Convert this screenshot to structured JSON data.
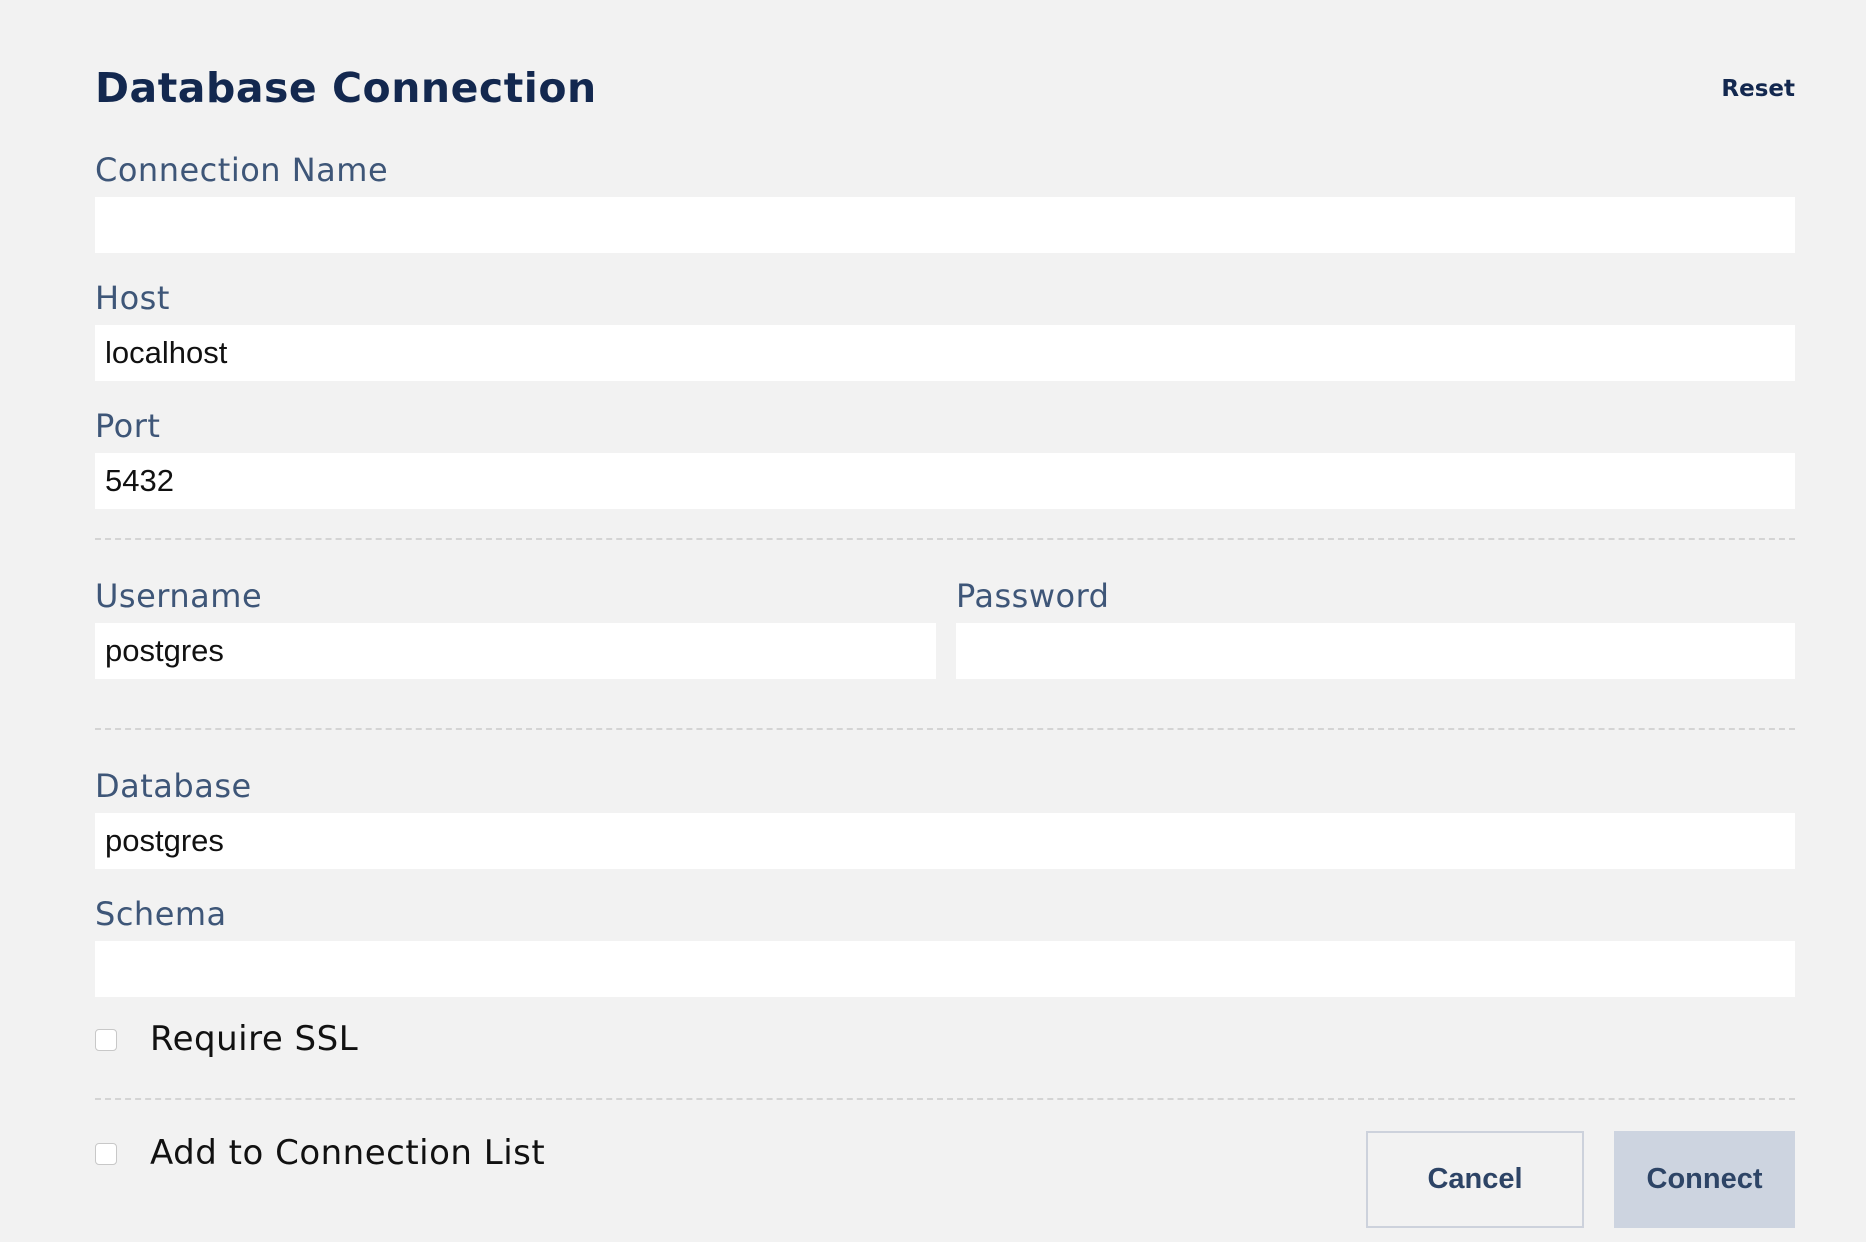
{
  "dialog": {
    "title": "Database Connection",
    "reset_label": "Reset"
  },
  "fields": {
    "connection_name": {
      "label": "Connection Name",
      "value": ""
    },
    "host": {
      "label": "Host",
      "value": "localhost"
    },
    "port": {
      "label": "Port",
      "value": "5432"
    },
    "username": {
      "label": "Username",
      "value": "postgres"
    },
    "password": {
      "label": "Password",
      "value": ""
    },
    "database": {
      "label": "Database",
      "value": "postgres"
    },
    "schema": {
      "label": "Schema",
      "value": ""
    }
  },
  "options": {
    "require_ssl": {
      "label": "Require SSL",
      "checked": false
    },
    "add_to_list": {
      "label": "Add to Connection List",
      "checked": false
    }
  },
  "actions": {
    "cancel_label": "Cancel",
    "connect_label": "Connect"
  },
  "colors": {
    "background": "#f2f2f2",
    "title": "#13284f",
    "label": "#3e5678",
    "connect_button": "#cdd4e0"
  }
}
